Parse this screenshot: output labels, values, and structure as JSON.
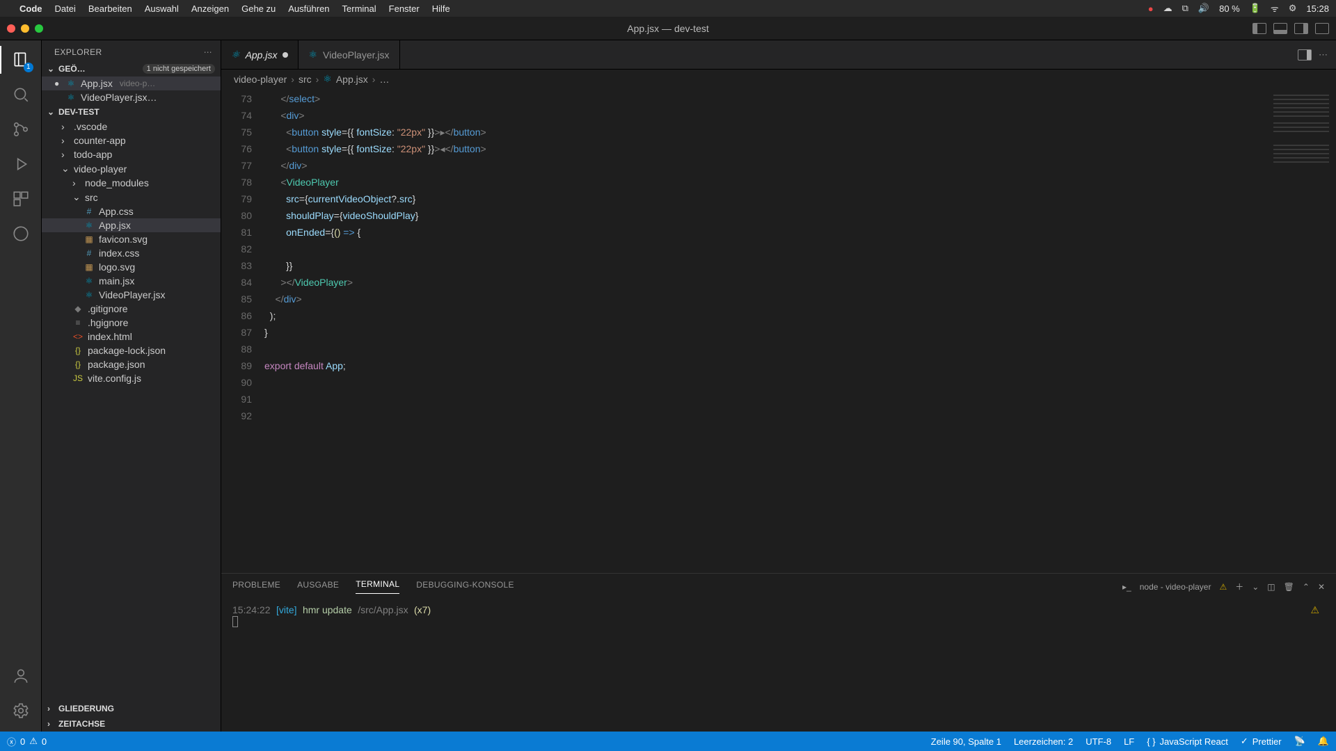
{
  "menubar": {
    "app": "Code",
    "items": [
      "Datei",
      "Bearbeiten",
      "Auswahl",
      "Anzeigen",
      "Gehe zu",
      "Ausführen",
      "Terminal",
      "Fenster",
      "Hilfe"
    ],
    "battery": "80 %",
    "clock": "15:28"
  },
  "titlebar": {
    "title": "App.jsx — dev-test"
  },
  "activitybar": {
    "explorer_badge": "1"
  },
  "sidebar": {
    "title": "EXPLORER",
    "open_editors_label": "GEÖ…",
    "open_editors_badge": "1 nicht gespeichert",
    "open_editors": [
      {
        "mod": "●",
        "name": "App.jsx",
        "meta": "video-p…"
      },
      {
        "mod": "",
        "name": "VideoPlayer.jsx…",
        "meta": ""
      }
    ],
    "workspace_label": "DEV-TEST",
    "tree": [
      {
        "type": "folder",
        "name": ".vscode",
        "open": false,
        "depth": 1
      },
      {
        "type": "folder",
        "name": "counter-app",
        "open": false,
        "depth": 1
      },
      {
        "type": "folder",
        "name": "todo-app",
        "open": false,
        "depth": 1
      },
      {
        "type": "folder",
        "name": "video-player",
        "open": true,
        "depth": 1
      },
      {
        "type": "folder",
        "name": "node_modules",
        "open": false,
        "depth": 2
      },
      {
        "type": "folder",
        "name": "src",
        "open": true,
        "depth": 2
      },
      {
        "type": "file",
        "name": "App.css",
        "icon": "#",
        "color": "#519aba",
        "depth": 3
      },
      {
        "type": "file",
        "name": "App.jsx",
        "icon": "⚛",
        "color": "#0098ba",
        "depth": 3,
        "active": true
      },
      {
        "type": "file",
        "name": "favicon.svg",
        "icon": "▦",
        "color": "#c09553",
        "depth": 3
      },
      {
        "type": "file",
        "name": "index.css",
        "icon": "#",
        "color": "#519aba",
        "depth": 3
      },
      {
        "type": "file",
        "name": "logo.svg",
        "icon": "▦",
        "color": "#c09553",
        "depth": 3
      },
      {
        "type": "file",
        "name": "main.jsx",
        "icon": "⚛",
        "color": "#0098ba",
        "depth": 3
      },
      {
        "type": "file",
        "name": "VideoPlayer.jsx",
        "icon": "⚛",
        "color": "#0098ba",
        "depth": 3
      },
      {
        "type": "file",
        "name": ".gitignore",
        "icon": "◆",
        "color": "#7a7a7a",
        "depth": 2
      },
      {
        "type": "file",
        "name": ".hgignore",
        "icon": "≡",
        "color": "#7a7a7a",
        "depth": 2
      },
      {
        "type": "file",
        "name": "index.html",
        "icon": "<>",
        "color": "#e44d26",
        "depth": 2
      },
      {
        "type": "file",
        "name": "package-lock.json",
        "icon": "{}",
        "color": "#cbcb41",
        "depth": 2
      },
      {
        "type": "file",
        "name": "package.json",
        "icon": "{}",
        "color": "#cbcb41",
        "depth": 2
      },
      {
        "type": "file",
        "name": "vite.config.js",
        "icon": "JS",
        "color": "#cbcb41",
        "depth": 2
      }
    ],
    "outline_label": "GLIEDERUNG",
    "timeline_label": "ZEITACHSE"
  },
  "tabs": [
    {
      "name": "App.jsx",
      "active": true,
      "modified": true
    },
    {
      "name": "VideoPlayer.jsx",
      "active": false,
      "modified": false
    }
  ],
  "breadcrumb": [
    "video-player",
    "src",
    "App.jsx",
    "…"
  ],
  "code": {
    "first_line": 73,
    "lines": [
      [
        [
          "dim",
          "      </"
        ],
        [
          "tag",
          "select"
        ],
        [
          "dim",
          ">"
        ]
      ],
      [
        [
          "dim",
          "      <"
        ],
        [
          "tag",
          "div"
        ],
        [
          "dim",
          ">"
        ]
      ],
      [
        [
          "dim",
          "        <"
        ],
        [
          "tag",
          "button"
        ],
        [
          "op",
          " "
        ],
        [
          "attr",
          "style"
        ],
        [
          "op",
          "="
        ],
        [
          "brace",
          "{{ "
        ],
        [
          "attr",
          "fontSize"
        ],
        [
          "op",
          ": "
        ],
        [
          "str",
          "\"22px\""
        ],
        [
          "brace",
          " }}"
        ],
        [
          "dim",
          ">▸</"
        ],
        [
          "tag",
          "button"
        ],
        [
          "dim",
          ">"
        ]
      ],
      [
        [
          "dim",
          "        <"
        ],
        [
          "tag",
          "button"
        ],
        [
          "op",
          " "
        ],
        [
          "attr",
          "style"
        ],
        [
          "op",
          "="
        ],
        [
          "brace",
          "{{ "
        ],
        [
          "attr",
          "fontSize"
        ],
        [
          "op",
          ": "
        ],
        [
          "str",
          "\"22px\""
        ],
        [
          "brace",
          " }}"
        ],
        [
          "dim",
          ">◂</"
        ],
        [
          "tag",
          "button"
        ],
        [
          "dim",
          ">"
        ]
      ],
      [
        [
          "dim",
          "      </"
        ],
        [
          "tag",
          "div"
        ],
        [
          "dim",
          ">"
        ]
      ],
      [
        [
          "dim",
          "      <"
        ],
        [
          "component",
          "VideoPlayer"
        ]
      ],
      [
        [
          "op",
          "        "
        ],
        [
          "attr",
          "src"
        ],
        [
          "op",
          "="
        ],
        [
          "brace",
          "{"
        ],
        [
          "attr",
          "currentVideoObject"
        ],
        [
          "op",
          "?."
        ],
        [
          "attr",
          "src"
        ],
        [
          "brace",
          "}"
        ]
      ],
      [
        [
          "op",
          "        "
        ],
        [
          "attr",
          "shouldPlay"
        ],
        [
          "op",
          "="
        ],
        [
          "brace",
          "{"
        ],
        [
          "attr",
          "videoShouldPlay"
        ],
        [
          "brace",
          "}"
        ]
      ],
      [
        [
          "op",
          "        "
        ],
        [
          "attr",
          "onEnded"
        ],
        [
          "op",
          "="
        ],
        [
          "brace",
          "{"
        ],
        [
          "func",
          "()"
        ],
        [
          "op",
          " "
        ],
        [
          "tag",
          "=>"
        ],
        [
          "op",
          " "
        ],
        [
          "brace",
          "{"
        ]
      ],
      [
        [
          "op",
          ""
        ]
      ],
      [
        [
          "op",
          "        "
        ],
        [
          "brace",
          "}}"
        ]
      ],
      [
        [
          "dim",
          "      ></"
        ],
        [
          "component",
          "VideoPlayer"
        ],
        [
          "dim",
          ">"
        ]
      ],
      [
        [
          "dim",
          "    </"
        ],
        [
          "tag",
          "div"
        ],
        [
          "dim",
          ">"
        ]
      ],
      [
        [
          "op",
          "  );"
        ]
      ],
      [
        [
          "brace",
          "}"
        ]
      ],
      [
        [
          "op",
          ""
        ]
      ],
      [
        [
          "kw",
          "export"
        ],
        [
          "op",
          " "
        ],
        [
          "kw",
          "default"
        ],
        [
          "op",
          " "
        ],
        [
          "attr",
          "App"
        ],
        [
          "op",
          ";"
        ]
      ],
      [
        [
          "op",
          ""
        ]
      ],
      [
        [
          "cursor",
          ""
        ]
      ],
      [
        [
          "op",
          ""
        ]
      ]
    ]
  },
  "panel": {
    "tabs": [
      "PROBLEME",
      "AUSGABE",
      "TERMINAL",
      "DEBUGGING-KONSOLE"
    ],
    "active_tab": 2,
    "terminal_label": "node - video-player",
    "terminal_line": {
      "time": "15:24:22",
      "tag": "[vite]",
      "msg": "hmr update",
      "path": "/src/App.jsx",
      "count": "(x7)"
    }
  },
  "statusbar": {
    "errors": "0",
    "warnings": "0",
    "position": "Zeile 90, Spalte 1",
    "spaces": "Leerzeichen: 2",
    "encoding": "UTF-8",
    "eol": "LF",
    "language": "JavaScript React",
    "prettier": "Prettier"
  }
}
